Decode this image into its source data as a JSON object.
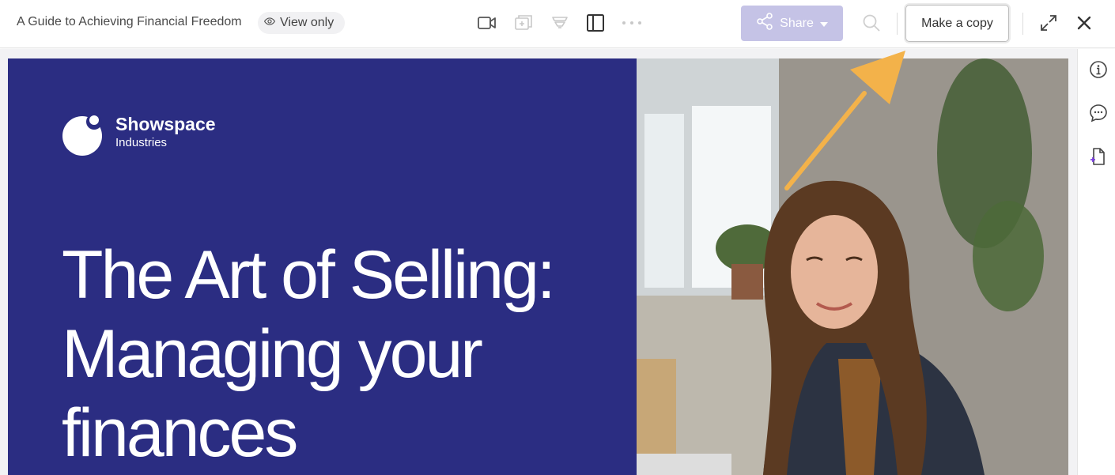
{
  "header": {
    "doc_title": "A Guide to Achieving Financial Freedom",
    "view_mode": "View only",
    "share_label": "Share",
    "copy_label": "Make a copy"
  },
  "slide": {
    "brand_name": "Showspace",
    "brand_sub": "Industries",
    "headline_line1": "The Art of Selling:",
    "headline_line2": "Managing your",
    "headline_line3": "finances"
  },
  "colors": {
    "slide_bg": "#2b2d82",
    "share_bg": "#c5c3e6",
    "annotation_arrow": "#f3b24a"
  },
  "icons": [
    "eye-icon",
    "video-icon",
    "add-page-icon",
    "funnel-icon",
    "panel-layout-icon",
    "more-icon",
    "share-icon",
    "caret-down-icon",
    "search-icon",
    "expand-icon",
    "close-icon",
    "info-icon",
    "comment-icon",
    "page-add-icon"
  ]
}
